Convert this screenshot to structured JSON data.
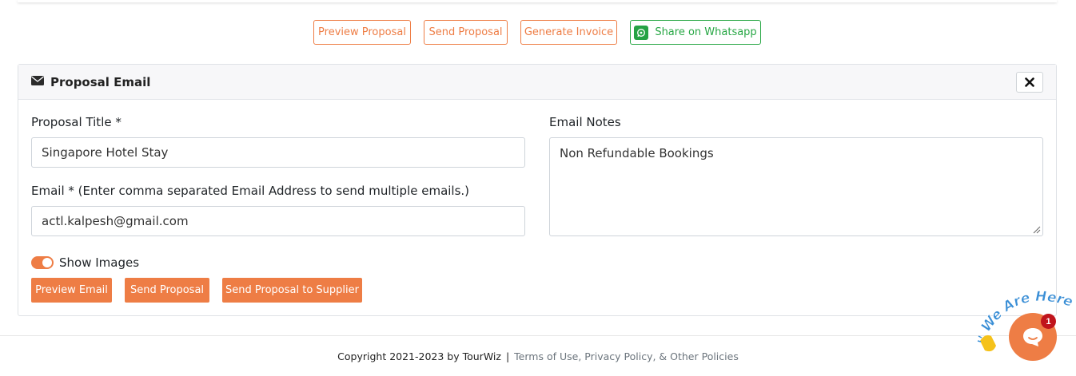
{
  "actions": {
    "preview_proposal": "Preview Proposal",
    "send_proposal": "Send Proposal",
    "generate_invoice": "Generate Invoice",
    "share_whatsapp": "Share on Whatsapp"
  },
  "card": {
    "title": "Proposal Email",
    "proposal_title_label": "Proposal Title *",
    "proposal_title_value": "Singapore Hotel Stay",
    "email_label": "Email * (Enter comma separated Email Address to send multiple emails.)",
    "email_value": "actl.kalpesh@gmail.com",
    "notes_label": "Email Notes",
    "notes_value": "Non Refundable Bookings",
    "show_images_label": "Show Images",
    "show_images_on": true,
    "buttons": {
      "preview_email": "Preview Email",
      "send_proposal": "Send Proposal",
      "send_to_supplier": "Send Proposal to Supplier"
    }
  },
  "footer": {
    "copyright": "Copyright 2021-2023 by TourWiz",
    "separator": "|",
    "links": "Terms of Use, Privacy Policy, & Other Policies"
  },
  "chat": {
    "badge_count": "1",
    "tagline": "We Are Here!"
  },
  "colors": {
    "accent": "#ee7d45",
    "whatsapp": "#28a745",
    "badge": "#c0141c"
  },
  "icons": [
    "envelope-icon",
    "close-icon",
    "whatsapp-icon",
    "chat-icon",
    "waving-hand-icon"
  ]
}
